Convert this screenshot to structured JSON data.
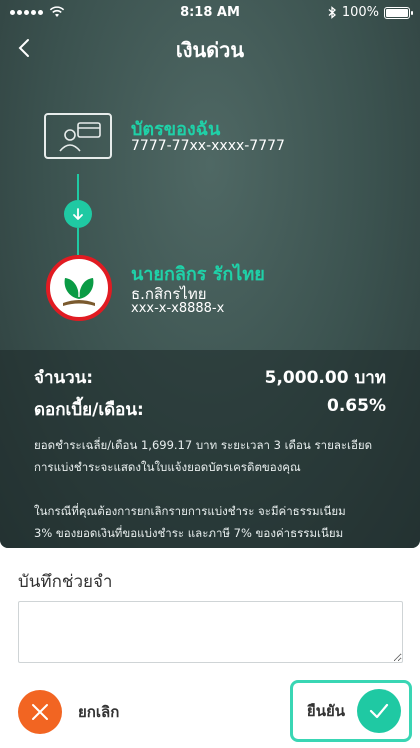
{
  "status_bar": {
    "time": "8:18 AM",
    "battery": "100%"
  },
  "header": {
    "title": "เงินด่วน"
  },
  "from": {
    "title": "บัตรของฉัน",
    "card_number": "7777-77xx-xxxx-7777"
  },
  "to": {
    "name": "นายกลิกร รักไทย",
    "bank": "ธ.กสิกรไทย",
    "account": "xxx-x-x8888-x"
  },
  "summary": {
    "amount_label": "จำนวน:",
    "amount_value": "5,000.00 บาท",
    "interest_label": "ดอกเบี้ย/เดือน:",
    "interest_value": "0.65%",
    "note1_line1": "ยอดชำระเฉลี่ย/เดือน 1,699.17 บาท ระยะเวลา 3 เดือน รายละเอียด",
    "note1_line2": "การแบ่งชำระจะแสดงในใบแจ้งยอดบัตรเครดิตของคุณ",
    "note2_line1": "ในกรณีที่คุณต้องการยกเลิกรายการแบ่งชำระ จะมีค่าธรรมเนียม",
    "note2_line2": "3% ของยอดเงินที่ขอแบ่งชำระ และภาษี 7% ของค่าธรรมเนียม"
  },
  "memo": {
    "label": "บันทึกช่วยจำ",
    "value": ""
  },
  "actions": {
    "cancel_label": "ยกเลิก",
    "confirm_label": "ยืนยัน"
  },
  "colors": {
    "accent": "#1fc9a3",
    "cancel": "#f26522",
    "brand_red": "#e11b22",
    "brand_green": "#0a9b45"
  },
  "icons": [
    "wifi-icon",
    "back-icon",
    "card-icon",
    "arrow-down-icon",
    "kbank-logo",
    "bluetooth-icon",
    "battery-icon",
    "close-icon",
    "check-icon"
  ]
}
